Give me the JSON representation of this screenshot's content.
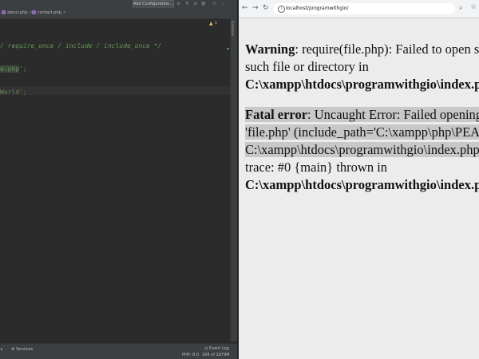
{
  "ide": {
    "tabs": [
      {
        "label": "about.php"
      },
      {
        "label": "contact.php"
      }
    ],
    "add_config_label": "Add Configuration...",
    "database_label": "Database",
    "warning_count": "1",
    "code_lines": [
      {
        "text": "/ require_once / include / include_once */"
      },
      {
        "pre": "",
        "hl": "e.php",
        "post": "';"
      },
      {
        "text": "World';"
      }
    ],
    "status": {
      "left_label": "Services",
      "php_version": "PHP: 8.0",
      "memory": "184 of 1979M",
      "event_log": "Event Log"
    }
  },
  "browser": {
    "url": "localhost/programwithgio/",
    "back_icon": "arrow-left-icon",
    "forward_icon": "arrow-right-icon",
    "reload_icon": "reload-icon",
    "warning": {
      "label": "Warning",
      "line1": ": require(file.php): Failed to open s",
      "line2": "such file or directory in",
      "line3": "C:\\xampp\\htdocs\\programwithgio\\index.p"
    },
    "fatal": {
      "label": "Fatal error",
      "line1": ": Uncaught Error: Failed opening",
      "line2": "'file.php' (include_path='C:\\xampp\\php\\PEA",
      "line3": "C:\\xampp\\htdocs\\programwithgio\\index.php",
      "line4": "trace: #0 {main} thrown in",
      "line5": "C:\\xampp\\htdocs\\programwithgio\\index.p"
    }
  }
}
